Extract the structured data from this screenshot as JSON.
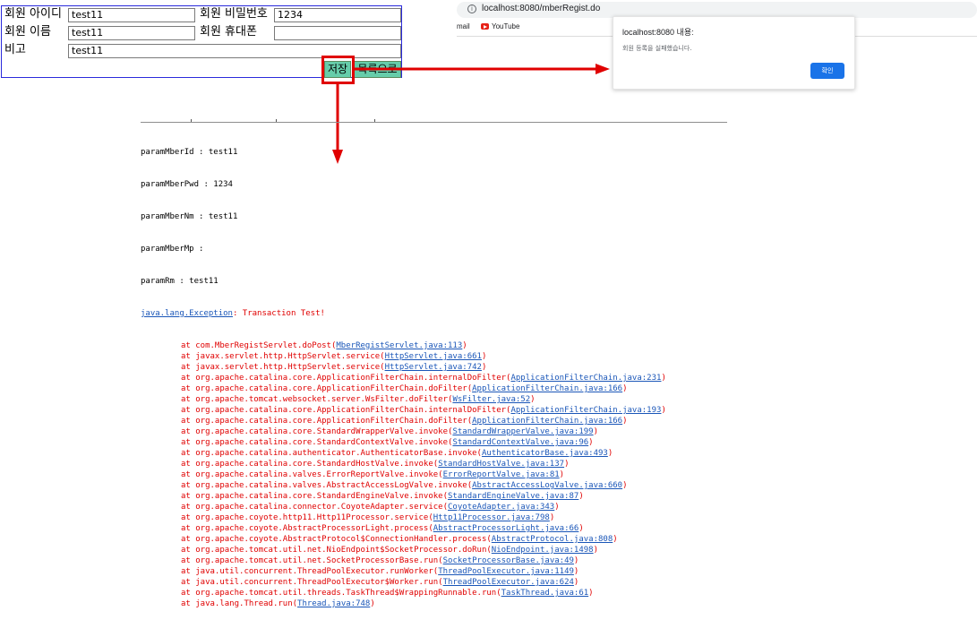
{
  "form": {
    "id_label": "회원 아이디",
    "id_value": "test11",
    "pwd_label": "회원 비밀번호",
    "pwd_value": "1234",
    "name_label": "회원 이름",
    "name_value": "test11",
    "phone_label": "회원 휴대폰",
    "phone_value": "",
    "rm_label": "비고",
    "rm_value": "test11",
    "save_button": "저장",
    "list_button": "목록으로"
  },
  "browser": {
    "info_icon": "i",
    "url": "localhost:8080/mberRegist.do",
    "bookmarks": [
      "mail",
      "YouTube"
    ]
  },
  "dialog": {
    "title": "localhost:8080 내용:",
    "message": "회원 등록을 실패했습니다.",
    "ok_button": "확인"
  },
  "console": {
    "params": [
      "paramMberId : test11",
      "paramMberPwd : 1234",
      "paramMberNm : test11",
      "paramMberMp :",
      "paramRm : test11"
    ],
    "exception_class": "java.lang.Exception",
    "exception_message": ": Transaction Test!",
    "frames": [
      {
        "method": "at com.MberRegistServlet.doPost(",
        "source": "MberRegistServlet.java:113"
      },
      {
        "method": "at javax.servlet.http.HttpServlet.service(",
        "source": "HttpServlet.java:661"
      },
      {
        "method": "at javax.servlet.http.HttpServlet.service(",
        "source": "HttpServlet.java:742"
      },
      {
        "method": "at org.apache.catalina.core.ApplicationFilterChain.internalDoFilter(",
        "source": "ApplicationFilterChain.java:231"
      },
      {
        "method": "at org.apache.catalina.core.ApplicationFilterChain.doFilter(",
        "source": "ApplicationFilterChain.java:166"
      },
      {
        "method": "at org.apache.tomcat.websocket.server.WsFilter.doFilter(",
        "source": "WsFilter.java:52"
      },
      {
        "method": "at org.apache.catalina.core.ApplicationFilterChain.internalDoFilter(",
        "source": "ApplicationFilterChain.java:193"
      },
      {
        "method": "at org.apache.catalina.core.ApplicationFilterChain.doFilter(",
        "source": "ApplicationFilterChain.java:166"
      },
      {
        "method": "at org.apache.catalina.core.StandardWrapperValve.invoke(",
        "source": "StandardWrapperValve.java:199"
      },
      {
        "method": "at org.apache.catalina.core.StandardContextValve.invoke(",
        "source": "StandardContextValve.java:96"
      },
      {
        "method": "at org.apache.catalina.authenticator.AuthenticatorBase.invoke(",
        "source": "AuthenticatorBase.java:493"
      },
      {
        "method": "at org.apache.catalina.core.StandardHostValve.invoke(",
        "source": "StandardHostValve.java:137"
      },
      {
        "method": "at org.apache.catalina.valves.ErrorReportValve.invoke(",
        "source": "ErrorReportValve.java:81"
      },
      {
        "method": "at org.apache.catalina.valves.AbstractAccessLogValve.invoke(",
        "source": "AbstractAccessLogValve.java:660"
      },
      {
        "method": "at org.apache.catalina.core.StandardEngineValve.invoke(",
        "source": "StandardEngineValve.java:87"
      },
      {
        "method": "at org.apache.catalina.connector.CoyoteAdapter.service(",
        "source": "CoyoteAdapter.java:343"
      },
      {
        "method": "at org.apache.coyote.http11.Http11Processor.service(",
        "source": "Http11Processor.java:798"
      },
      {
        "method": "at org.apache.coyote.AbstractProcessorLight.process(",
        "source": "AbstractProcessorLight.java:66"
      },
      {
        "method": "at org.apache.coyote.AbstractProtocol$ConnectionHandler.process(",
        "source": "AbstractProtocol.java:808"
      },
      {
        "method": "at org.apache.tomcat.util.net.NioEndpoint$SocketProcessor.doRun(",
        "source": "NioEndpoint.java:1498"
      },
      {
        "method": "at org.apache.tomcat.util.net.SocketProcessorBase.run(",
        "source": "SocketProcessorBase.java:49"
      },
      {
        "method": "at java.util.concurrent.ThreadPoolExecutor.runWorker(",
        "source": "ThreadPoolExecutor.java:1149"
      },
      {
        "method": "at java.util.concurrent.ThreadPoolExecutor$Worker.run(",
        "source": "ThreadPoolExecutor.java:624"
      },
      {
        "method": "at org.apache.tomcat.util.threads.TaskThread$WrappingRunnable.run(",
        "source": "TaskThread.java:61"
      },
      {
        "method": "at java.lang.Thread.run(",
        "source": "Thread.java:748"
      }
    ]
  },
  "colors": {
    "accent_red": "#e00000",
    "button_green": "#66cdaa",
    "dialog_blue": "#1a73e8",
    "link_blue": "#1a56b8",
    "form_border": "#2b2bdb"
  },
  "icons": {
    "info": "info-icon",
    "youtube": "youtube-icon",
    "arrows": "arrow-right-icon, arrow-down-icon"
  }
}
